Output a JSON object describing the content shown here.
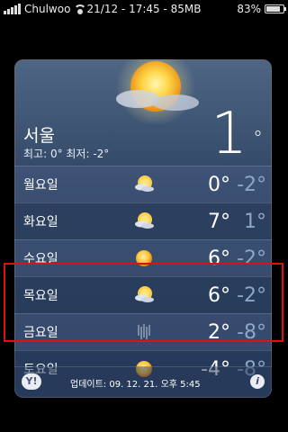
{
  "status": {
    "carrier": "Chulwoo",
    "center": "21/12 - 17:45 - 85MB",
    "battery": "83%",
    "battery_level": 0.83,
    "signal_bars": 5
  },
  "weather": {
    "city": "서울",
    "hilo": "최고: 0° 최저: -2°",
    "current_temp": "1",
    "current_deg": "°",
    "current_icon": "partly-cloudy-sun-icon",
    "forecast": [
      {
        "day": "월요일",
        "icon": "partly-cloudy-sun-icon",
        "hi": "0°",
        "lo": "-2°"
      },
      {
        "day": "화요일",
        "icon": "partly-cloudy-sun-icon",
        "hi": "7°",
        "lo": "1°"
      },
      {
        "day": "수요일",
        "icon": "sun-icon",
        "hi": "6°",
        "lo": "-2°"
      },
      {
        "day": "목요일",
        "icon": "partly-cloudy-sun-icon",
        "hi": "6°",
        "lo": "-2°"
      },
      {
        "day": "금요일",
        "icon": "rain-icon",
        "hi": "2°",
        "lo": "-8°"
      },
      {
        "day": "토요일",
        "icon": "sun-icon",
        "hi": "-4°",
        "lo": "-8°"
      }
    ],
    "yahoo_label": "Y!",
    "updated": "업데이트: 09. 12. 21. 오후 5:45",
    "info_label": "i"
  },
  "colors": {
    "highlight": "#dd1111",
    "low_temp": "#8ea7c8"
  }
}
